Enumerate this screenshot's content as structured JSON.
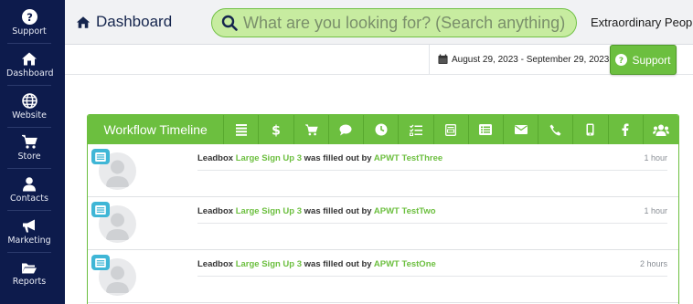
{
  "sidebar": {
    "items": [
      {
        "label": "Support",
        "icon": "question-circle-icon"
      },
      {
        "label": "Dashboard",
        "icon": "home-icon"
      },
      {
        "label": "Website",
        "icon": "globe-icon"
      },
      {
        "label": "Store",
        "icon": "cart-icon"
      },
      {
        "label": "Contacts",
        "icon": "person-icon"
      },
      {
        "label": "Marketing",
        "icon": "megaphone-icon"
      },
      {
        "label": "Reports",
        "icon": "folder-icon"
      }
    ]
  },
  "header": {
    "title": "Dashboard",
    "search_placeholder": "What are you looking for? (Search anything)",
    "company": "Extraordinary People"
  },
  "subbar": {
    "date_range": "August 29, 2023 - September 29, 2023",
    "support_label": "Support"
  },
  "workflow": {
    "title": "Workflow Timeline",
    "tools": [
      "list-icon",
      "dollar-icon",
      "cart-icon",
      "chat-icon",
      "clock-icon",
      "checklist-icon",
      "form-icon",
      "table-icon",
      "mail-icon",
      "phone-icon",
      "mobile-icon",
      "facebook-icon",
      "users-icon"
    ],
    "entries": [
      {
        "prefix": "Leadbox",
        "form": "Large Sign Up 3",
        "middle": "was filled out by",
        "person": "APWT TestThree",
        "time": "1 hour"
      },
      {
        "prefix": "Leadbox",
        "form": "Large Sign Up 3",
        "middle": "was filled out by",
        "person": "APWT TestTwo",
        "time": "1 hour"
      },
      {
        "prefix": "Leadbox",
        "form": "Large Sign Up 3",
        "middle": "was filled out by",
        "person": "APWT TestOne",
        "time": "2 hours"
      }
    ]
  },
  "colors": {
    "sidebar": "#0d1b4c",
    "accent": "#6cbf3f",
    "badge": "#3fb6d6"
  }
}
